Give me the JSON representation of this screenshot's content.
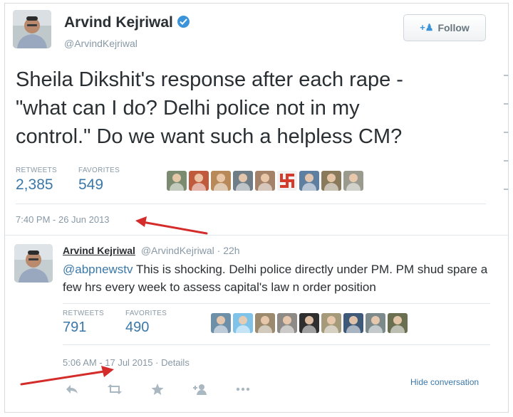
{
  "tweet": {
    "author_name": "Arvind Kejriwal",
    "author_handle": "@ArvindKejriwal",
    "follow_label": "Follow",
    "text": "Sheila Dikshit's response after each rape -\n\"what can I do? Delhi police not in my\ncontrol.\" Do we want such a helpless CM?",
    "retweets_label": "RETWEETS",
    "retweets_count": "2,385",
    "favorites_label": "FAVORITES",
    "favorites_count": "549",
    "timestamp": "7:40 PM - 26 Jun 2013"
  },
  "reply": {
    "author_name": "Arvind Kejriwal",
    "author_handle": "@ArvindKejriwal",
    "separator": "·",
    "age": "22h",
    "mention": "@abpnewstv",
    "text": " This is shocking. Delhi police directly under PM. PM shud spare a few hrs every week to assess capital's law n order position",
    "retweets_label": "RETWEETS",
    "retweets_count": "791",
    "favorites_label": "FAVORITES",
    "favorites_count": "490",
    "timestamp": "5:06 AM - 17 Jul 2015",
    "details_label": "Details",
    "hide_conversation_label": "Hide conversation"
  },
  "favoriters_row1": [
    {
      "icon": "user-avatar",
      "color": "#7a8b70"
    },
    {
      "icon": "user-avatar",
      "color": "#c05a3c"
    },
    {
      "icon": "user-avatar",
      "color": "#b88a5a"
    },
    {
      "icon": "user-avatar",
      "color": "#6f7d86"
    },
    {
      "icon": "user-avatar",
      "color": "#a4826a"
    },
    {
      "icon": "swastika-avatar",
      "color": "#e5e5e5"
    },
    {
      "icon": "user-avatar",
      "color": "#5f7fa0"
    },
    {
      "icon": "user-avatar",
      "color": "#8a7a5c"
    },
    {
      "icon": "user-avatar",
      "color": "#9a9a8e"
    }
  ],
  "favoriters_row2": [
    {
      "icon": "user-avatar",
      "color": "#6d8fa8"
    },
    {
      "icon": "user-avatar",
      "color": "#7fc4e8"
    },
    {
      "icon": "user-avatar",
      "color": "#9c8a6e"
    },
    {
      "icon": "user-avatar",
      "color": "#8e8a86"
    },
    {
      "icon": "user-avatar",
      "color": "#2f2f2f"
    },
    {
      "icon": "user-avatar",
      "color": "#a59a7a"
    },
    {
      "icon": "user-avatar",
      "color": "#3e5a78"
    },
    {
      "icon": "user-avatar",
      "color": "#7c8a8c"
    },
    {
      "icon": "user-avatar",
      "color": "#6b6f52"
    }
  ],
  "colors": {
    "link_blue": "#3b78a8",
    "verified_blue": "#3b94d9",
    "annotation_arrow": "#d42b2b"
  }
}
